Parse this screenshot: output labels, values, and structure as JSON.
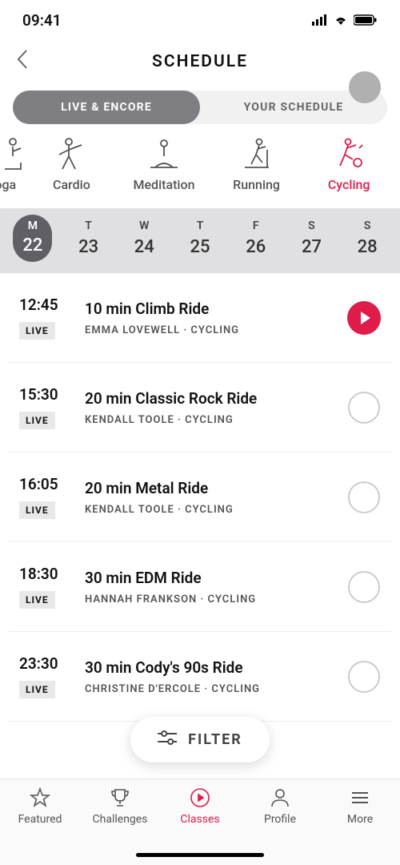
{
  "status": {
    "time": "09:41"
  },
  "header": {
    "title": "SCHEDULE"
  },
  "segments": {
    "live_encore": "LIVE & ENCORE",
    "your_schedule": "YOUR SCHEDULE"
  },
  "categories": [
    {
      "label": "Yoga",
      "icon": "yoga-icon",
      "partial": true
    },
    {
      "label": "Cardio",
      "icon": "cardio-icon"
    },
    {
      "label": "Meditation",
      "icon": "meditation-icon"
    },
    {
      "label": "Running",
      "icon": "running-icon"
    },
    {
      "label": "Cycling",
      "icon": "cycling-icon",
      "active": true
    }
  ],
  "days": [
    {
      "letter": "M",
      "num": "22",
      "selected": true
    },
    {
      "letter": "T",
      "num": "23"
    },
    {
      "letter": "W",
      "num": "24"
    },
    {
      "letter": "T",
      "num": "25"
    },
    {
      "letter": "F",
      "num": "26"
    },
    {
      "letter": "S",
      "num": "27"
    },
    {
      "letter": "S",
      "num": "28"
    }
  ],
  "badge_text": "LIVE",
  "classes": [
    {
      "time": "12:45",
      "title": "10 min Climb Ride",
      "sub": "EMMA LOVEWELL   ·   CYCLING",
      "play": true
    },
    {
      "time": "15:30",
      "title": "20 min Classic Rock Ride",
      "sub": "KENDALL TOOLE   ·   CYCLING",
      "play": false
    },
    {
      "time": "16:05",
      "title": "20 min Metal Ride",
      "sub": "KENDALL TOOLE   ·   CYCLING",
      "play": false
    },
    {
      "time": "18:30",
      "title": "30 min EDM Ride",
      "sub": "HANNAH FRANKSON   ·   CYCLING",
      "play": false
    },
    {
      "time": "23:30",
      "title": "30 min Cody's 90s Ride",
      "sub": "CHRISTINE D'ERCOLE   ·   CYCLING",
      "play": false
    }
  ],
  "filter": {
    "label": "FILTER"
  },
  "tabs": {
    "featured": "Featured",
    "challenges": "Challenges",
    "classes": "Classes",
    "profile": "Profile",
    "more": "More"
  }
}
